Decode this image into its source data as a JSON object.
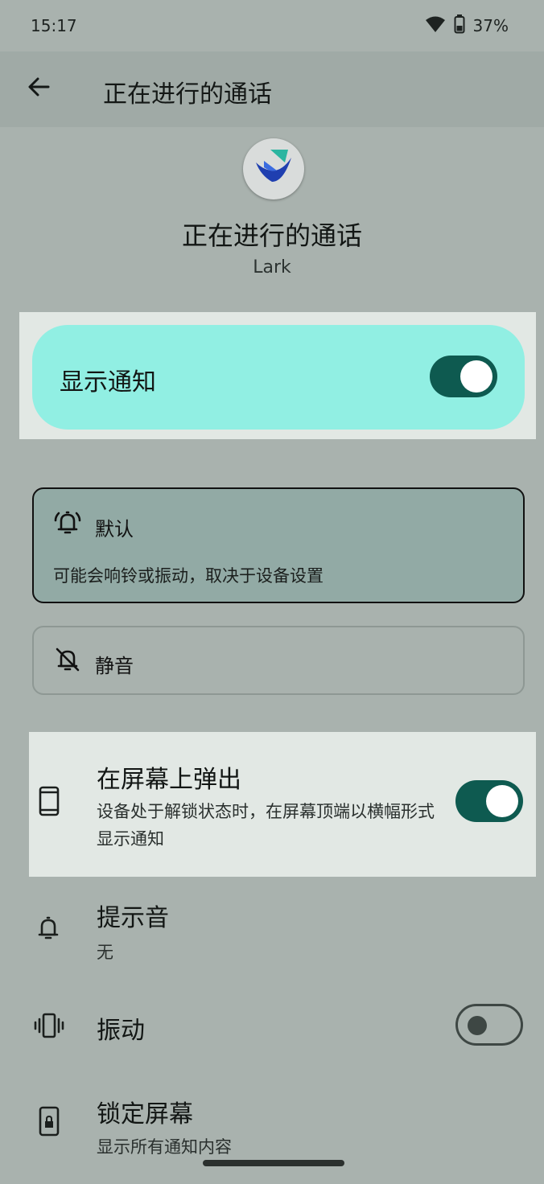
{
  "status_bar": {
    "time": "15:17",
    "battery_percent": "37%"
  },
  "app_bar": {
    "title": "正在进行的通话",
    "back_icon": "arrow-back-icon"
  },
  "header": {
    "channel_name": "正在进行的通话",
    "app_name": "Lark",
    "app_icon": "lark-logo"
  },
  "show_notifications": {
    "label": "显示通知",
    "enabled": true
  },
  "behavior_options": [
    {
      "name": "默认",
      "description": "可能会响铃或振动，取决于设备设置",
      "selected": true,
      "icon": "bell-ringing-icon"
    },
    {
      "name": "静音",
      "selected": false,
      "icon": "bell-off-icon"
    }
  ],
  "settings": {
    "popup": {
      "title": "在屏幕上弹出",
      "description": "设备处于解锁状态时，在屏幕顶端以横幅形式显示通知",
      "enabled": true,
      "icon": "phone-icon"
    },
    "sound": {
      "title": "提示音",
      "value": "无",
      "icon": "bell-icon"
    },
    "vibration": {
      "title": "振动",
      "enabled": false,
      "icon": "vibrate-icon"
    },
    "lock_screen": {
      "title": "锁定屏幕",
      "value": "显示所有通知内容",
      "icon": "lock-screen-icon"
    }
  },
  "colors": {
    "background": "#a9b2ae",
    "accent": "#0e5a50",
    "highlight_card": "#91efe3",
    "selected_option": "#92aaa5"
  }
}
